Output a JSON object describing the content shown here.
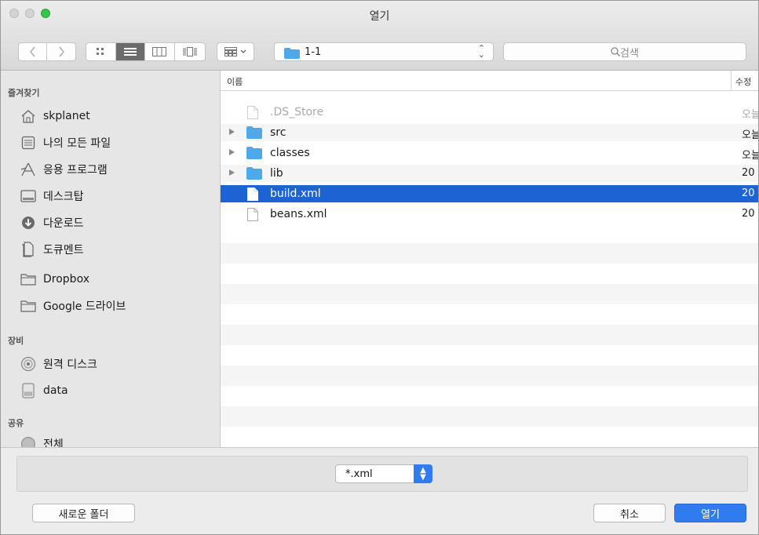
{
  "window": {
    "title": "열기"
  },
  "toolbar": {
    "location": "1-1",
    "search_placeholder": "검색"
  },
  "sidebar": {
    "sections": [
      {
        "label": "즐겨찾기"
      },
      {
        "label": "장비"
      },
      {
        "label": "공유"
      }
    ],
    "favorites": [
      {
        "label": "skplanet",
        "icon": "home-icon"
      },
      {
        "label": "나의 모든 파일",
        "icon": "all-files-icon"
      },
      {
        "label": "응용 프로그램",
        "icon": "applications-icon"
      },
      {
        "label": "데스크탑",
        "icon": "desktop-icon"
      },
      {
        "label": "다운로드",
        "icon": "downloads-icon"
      },
      {
        "label": "도큐멘트",
        "icon": "documents-icon"
      },
      {
        "label": "Dropbox",
        "icon": "folder-icon"
      },
      {
        "label": "Google 드라이브",
        "icon": "folder-icon"
      }
    ],
    "devices": [
      {
        "label": "원격 디스크",
        "icon": "remote-disc-icon"
      },
      {
        "label": "data",
        "icon": "drive-icon"
      }
    ],
    "shared": [
      {
        "label": "전체",
        "icon": "network-icon"
      }
    ]
  },
  "filelist": {
    "columns": {
      "name": "이름",
      "modified": "수정"
    },
    "rows": [
      {
        "name": ".DS_Store",
        "date": "오늘",
        "kind": "file",
        "dimmed": true
      },
      {
        "name": "src",
        "date": "오늘",
        "kind": "folder"
      },
      {
        "name": "classes",
        "date": "오늘",
        "kind": "folder"
      },
      {
        "name": "lib",
        "date": "20",
        "kind": "folder"
      },
      {
        "name": "build.xml",
        "date": "20",
        "kind": "file",
        "selected": true
      },
      {
        "name": "beans.xml",
        "date": "20",
        "kind": "file"
      }
    ]
  },
  "bottom": {
    "filter": "*.xml",
    "new_folder": "새로운 폴더",
    "cancel": "취소",
    "open": "열기"
  },
  "colors": {
    "selection": "#1e63d4",
    "accent": "#2f7bf0",
    "folder": "#4fa8e8"
  }
}
